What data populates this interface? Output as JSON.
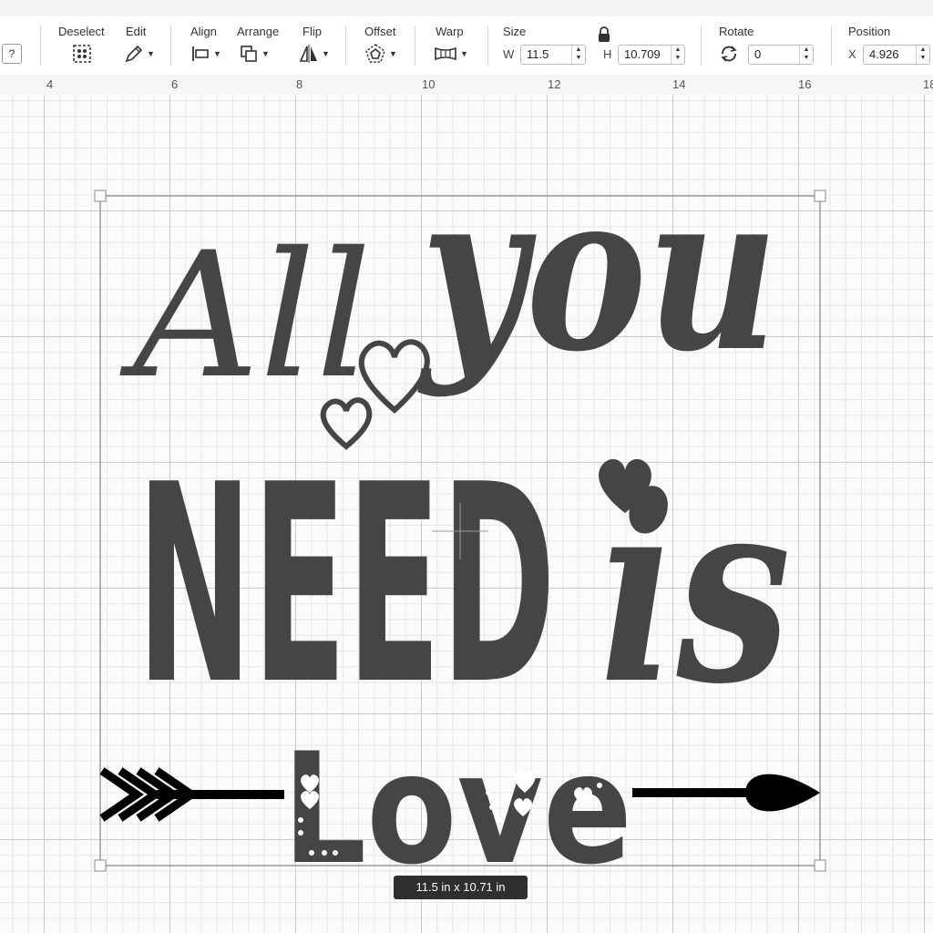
{
  "toolbar": {
    "help_label": "?",
    "deselect_label": "Deselect",
    "edit_label": "Edit",
    "align_label": "Align",
    "arrange_label": "Arrange",
    "flip_label": "Flip",
    "offset_label": "Offset",
    "warp_label": "Warp",
    "size_label": "Size",
    "width_prefix": "W",
    "width_value": "11.5",
    "height_prefix": "H",
    "height_value": "10.709",
    "rotate_label": "Rotate",
    "rotate_value": "0",
    "position_label": "Position",
    "x_prefix": "X",
    "x_value": "4.926"
  },
  "ruler": {
    "ticks": [
      "4",
      "6",
      "8",
      "10",
      "12",
      "14",
      "16",
      "18"
    ]
  },
  "design": {
    "line1_left": "All",
    "line1_right": "you",
    "line2_left": "NEED",
    "line2_right": "is",
    "line3": "Love",
    "fill_color": "#454545",
    "arrow_color": "#000000"
  },
  "selection": {
    "size_readout": "11.5  in x 10.71  in"
  }
}
